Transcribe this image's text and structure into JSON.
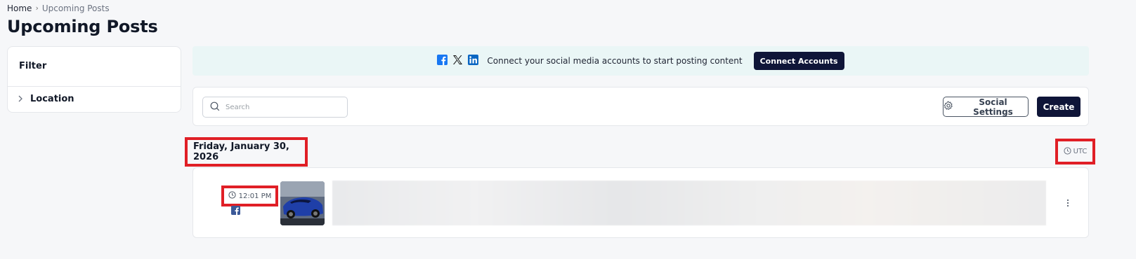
{
  "breadcrumb": {
    "home": "Home",
    "separator": "›",
    "current": "Upcoming Posts"
  },
  "page_title": "Upcoming Posts",
  "filter": {
    "title": "Filter",
    "location_label": "Location"
  },
  "banner": {
    "icons": [
      "facebook-icon",
      "x-icon",
      "linkedin-icon"
    ],
    "text": "Connect your social media accounts to start posting content",
    "button_label": "Connect Accounts"
  },
  "toolbar": {
    "search_placeholder": "Search",
    "social_settings_label": "Social Settings",
    "create_label": "Create"
  },
  "schedule": {
    "date_heading": "Friday, January 30, 2026",
    "timezone": "UTC",
    "posts": [
      {
        "time": "12:01 PM",
        "platform": "facebook-icon",
        "thumbnail": "blue-car-image"
      }
    ]
  },
  "colors": {
    "accent_dark": "#0f1538",
    "banner_bg": "#eaf6f6",
    "highlight_red": "#e01f26",
    "facebook_blue": "#1877f2",
    "linkedin_blue": "#0a66c2"
  }
}
